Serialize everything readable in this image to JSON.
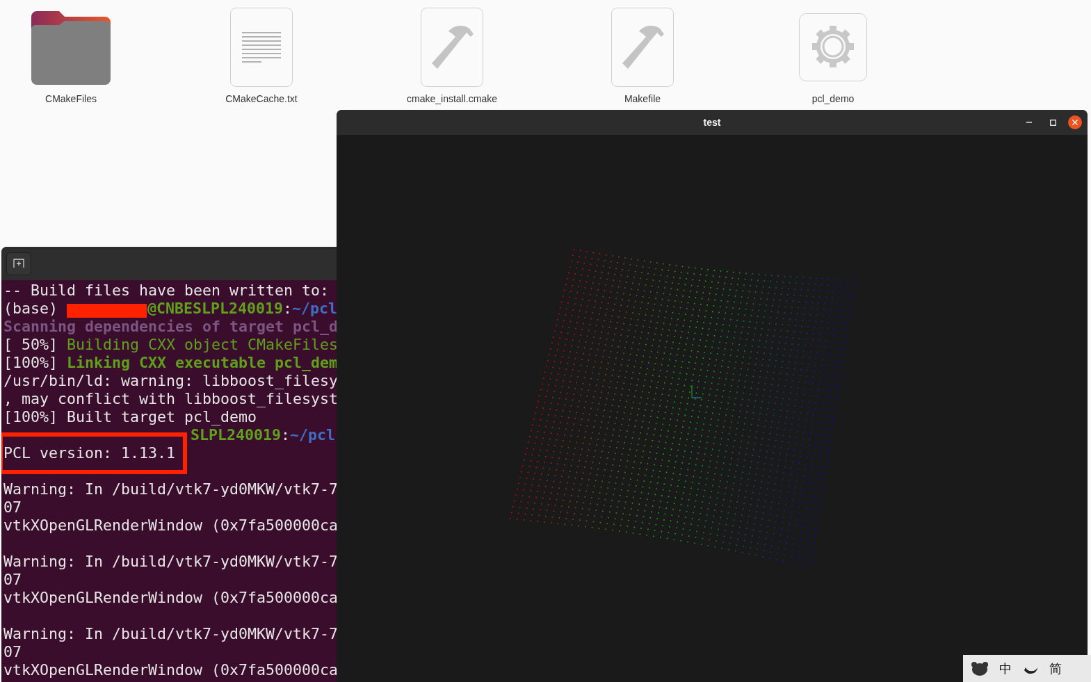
{
  "files": [
    {
      "name": "CMakeFiles",
      "kind": "folder"
    },
    {
      "name": "CMakeCache.txt",
      "kind": "text"
    },
    {
      "name": "cmake_install.cmake",
      "kind": "script"
    },
    {
      "name": "Makefile",
      "kind": "script"
    },
    {
      "name": "pcl_demo",
      "kind": "executable"
    }
  ],
  "viewer_window": {
    "title": "test"
  },
  "terminal": {
    "lines": [
      {
        "spans": [
          {
            "text": "-- Build files have been written to:",
            "kind": "plain"
          }
        ]
      },
      {
        "spans": [
          {
            "text": "(base) ",
            "kind": "plain"
          },
          {
            "kind": "redaction"
          },
          {
            "text": "@CNBESLPL240019",
            "kind": "green_bold"
          },
          {
            "text": ":",
            "kind": "plain"
          },
          {
            "text": "~/pcl",
            "kind": "blue_bold"
          }
        ]
      },
      {
        "spans": [
          {
            "text": "Scanning dependencies of target pcl_d",
            "kind": "magenta_bold"
          }
        ]
      },
      {
        "spans": [
          {
            "text": "[ 50%] ",
            "kind": "plain"
          },
          {
            "text": "Building CXX object CMakeFiles",
            "kind": "green"
          }
        ]
      },
      {
        "spans": [
          {
            "text": "[100%] ",
            "kind": "plain"
          },
          {
            "text": "Linking CXX executable pcl_dem",
            "kind": "green_bold"
          }
        ]
      },
      {
        "spans": [
          {
            "text": "/usr/bin/ld: warning: libboost_filesy",
            "kind": "plain"
          }
        ]
      },
      {
        "spans": [
          {
            "text": ", may conflict with libboost_filesyst",
            "kind": "plain"
          }
        ]
      },
      {
        "spans": [
          {
            "text": "[100%] Built target pcl_demo",
            "kind": "plain"
          }
        ]
      },
      {
        "spans": [
          {
            "kind": "covered"
          },
          {
            "text": "SLPL240019",
            "kind": "green_bold"
          },
          {
            "text": ":",
            "kind": "plain"
          },
          {
            "text": "~/pcl",
            "kind": "blue_bold"
          }
        ]
      },
      {
        "spans": [
          {
            "text": "PCL version: 1.13.1",
            "kind": "plain"
          }
        ]
      },
      {
        "kind": "blank"
      },
      {
        "spans": [
          {
            "text": "Warning: In /build/vtk7-yd0MKW/vtk7-7",
            "kind": "plain"
          }
        ]
      },
      {
        "spans": [
          {
            "text": "07",
            "kind": "plain"
          }
        ]
      },
      {
        "spans": [
          {
            "text": "vtkXOpenGLRenderWindow (0x7fa500000ca",
            "kind": "plain"
          }
        ]
      },
      {
        "kind": "blank"
      },
      {
        "spans": [
          {
            "text": "Warning: In /build/vtk7-yd0MKW/vtk7-7",
            "kind": "plain"
          }
        ]
      },
      {
        "spans": [
          {
            "text": "07",
            "kind": "plain"
          }
        ]
      },
      {
        "spans": [
          {
            "text": "vtkXOpenGLRenderWindow (0x7fa500000ca",
            "kind": "plain"
          }
        ]
      },
      {
        "kind": "blank"
      },
      {
        "spans": [
          {
            "text": "Warning: In /build/vtk7-yd0MKW/vtk7-7",
            "kind": "plain"
          }
        ]
      },
      {
        "spans": [
          {
            "text": "07",
            "kind": "plain"
          }
        ]
      },
      {
        "spans": [
          {
            "text": "vtkXOpenGLRenderWindow (0x7fa500000ca",
            "kind": "plain"
          }
        ]
      }
    ]
  },
  "tray": [
    {
      "kind": "icon"
    },
    {
      "kind": "text",
      "text": "中"
    },
    {
      "kind": "moon"
    },
    {
      "kind": "text",
      "text": "简"
    }
  ]
}
